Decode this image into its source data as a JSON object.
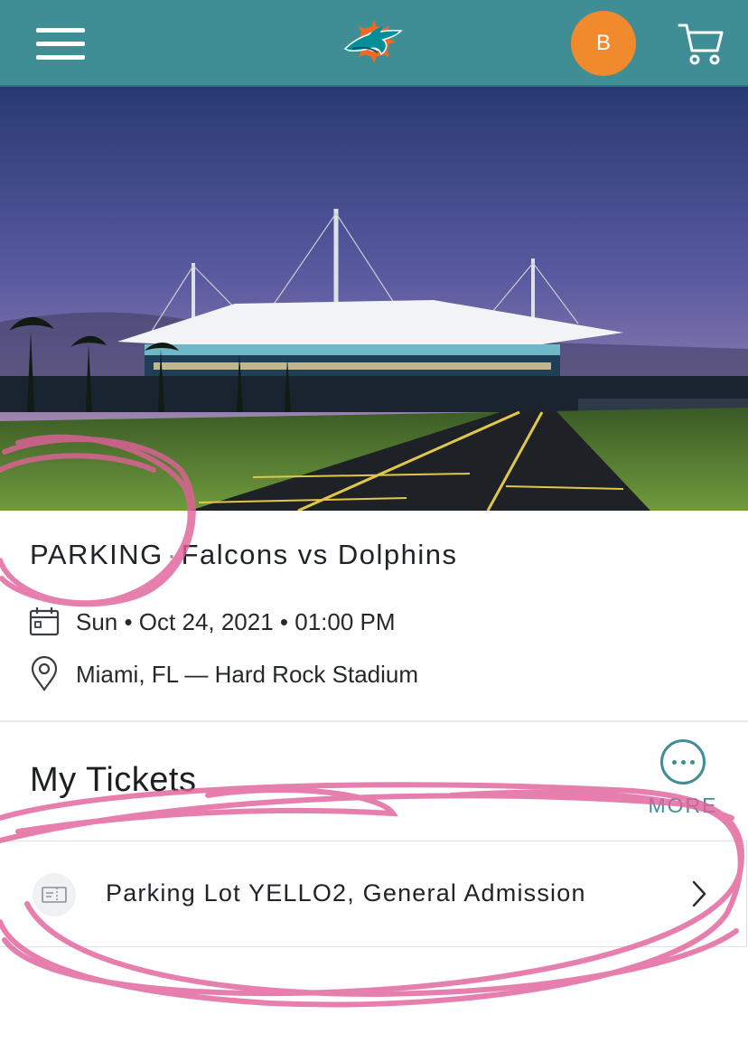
{
  "header": {
    "menu_icon": "hamburger-menu-icon",
    "logo": "dolphins-logo",
    "avatar_initial": "B",
    "cart_icon": "shopping-cart-icon"
  },
  "event": {
    "title_prefix": "PARKING",
    "separator": "·",
    "title_main": "Falcons vs Dolphins",
    "date_icon": "calendar-icon",
    "date": "Sun • Oct 24, 2021 • 01:00 PM",
    "location_icon": "location-pin-icon",
    "location": "Miami, FL — Hard Rock Stadium"
  },
  "tickets": {
    "heading": "My Tickets",
    "more_label": "MORE",
    "items": [
      {
        "label": "Parking Lot YELLO2, General Admission",
        "icon": "ticket-icon"
      }
    ]
  },
  "colors": {
    "header_bg": "#3f8e96",
    "avatar_bg": "#f08a2c",
    "accent": "#3f8e96",
    "annotation": "#e2609b"
  }
}
